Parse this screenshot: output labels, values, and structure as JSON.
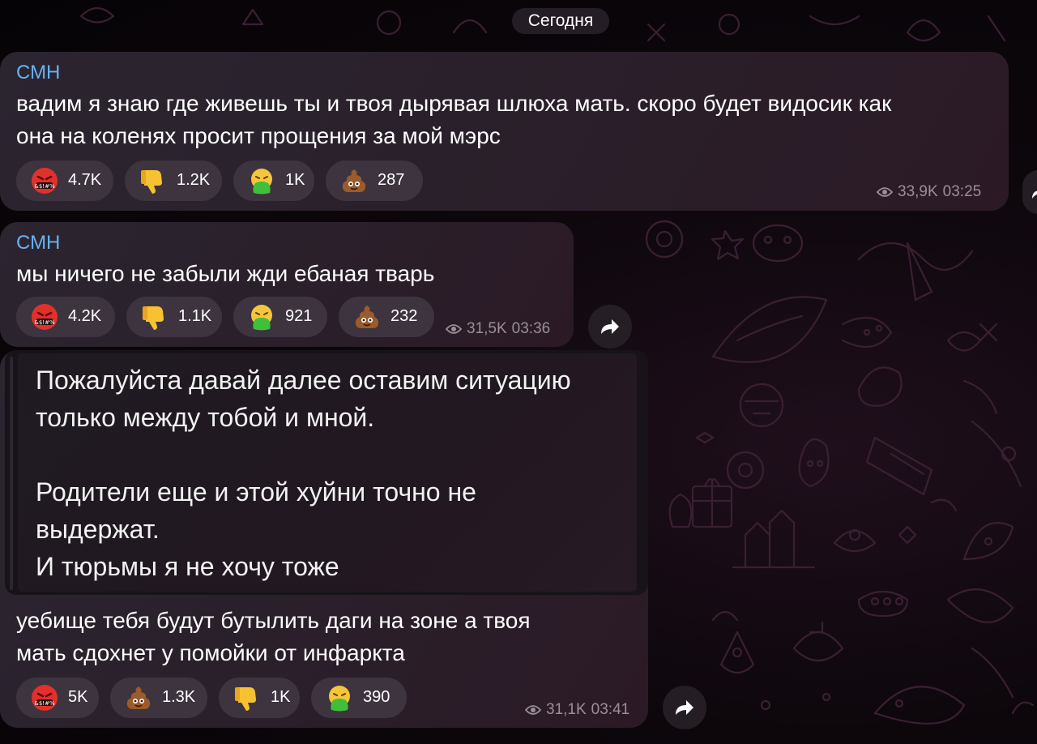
{
  "date_label": "Сегодня",
  "messages": [
    {
      "sender": "СМН",
      "text": "вадим я знаю где живешь ты и твоя дырявая шлюха мать. скоро будет видосик как\nона на коленях просит прощения за мой мэрс",
      "reactions": [
        {
          "emoji": "cursing-face-icon",
          "count": "4.7K"
        },
        {
          "emoji": "thumbs-down-icon",
          "count": "1.2K"
        },
        {
          "emoji": "vomiting-face-icon",
          "count": "1K"
        },
        {
          "emoji": "poop-icon",
          "count": "287"
        }
      ],
      "views": "33,9K",
      "time": "03:25"
    },
    {
      "sender": "СМН",
      "text": "мы ничего не забыли жди ебаная тварь",
      "reactions": [
        {
          "emoji": "cursing-face-icon",
          "count": "4.2K"
        },
        {
          "emoji": "thumbs-down-icon",
          "count": "1.1K"
        },
        {
          "emoji": "vomiting-face-icon",
          "count": "921"
        },
        {
          "emoji": "poop-icon",
          "count": "232"
        }
      ],
      "views": "31,5K",
      "time": "03:36"
    },
    {
      "quote": "Пожалуйста давай далее оставим ситуацию\nтолько между тобой и мной.\n\nРодители еще и этой хуйни точно не\nвыдержат.\nИ тюрьмы я не хочу тоже",
      "text": "уебище тебя будут бутылить даги на зоне а твоя\nмать сдохнет у помойки от инфаркта",
      "reactions": [
        {
          "emoji": "cursing-face-icon",
          "count": "5K"
        },
        {
          "emoji": "poop-icon",
          "count": "1.3K"
        },
        {
          "emoji": "thumbs-down-icon",
          "count": "1K"
        },
        {
          "emoji": "vomiting-face-icon",
          "count": "390"
        }
      ],
      "views": "31,1K",
      "time": "03:41"
    }
  ],
  "colors": {
    "sender": "#67b3f5",
    "bubble": "#2a2230",
    "reaction_bg": "#3d3440",
    "meta": "#9a8f98",
    "background": "#0d070c"
  }
}
